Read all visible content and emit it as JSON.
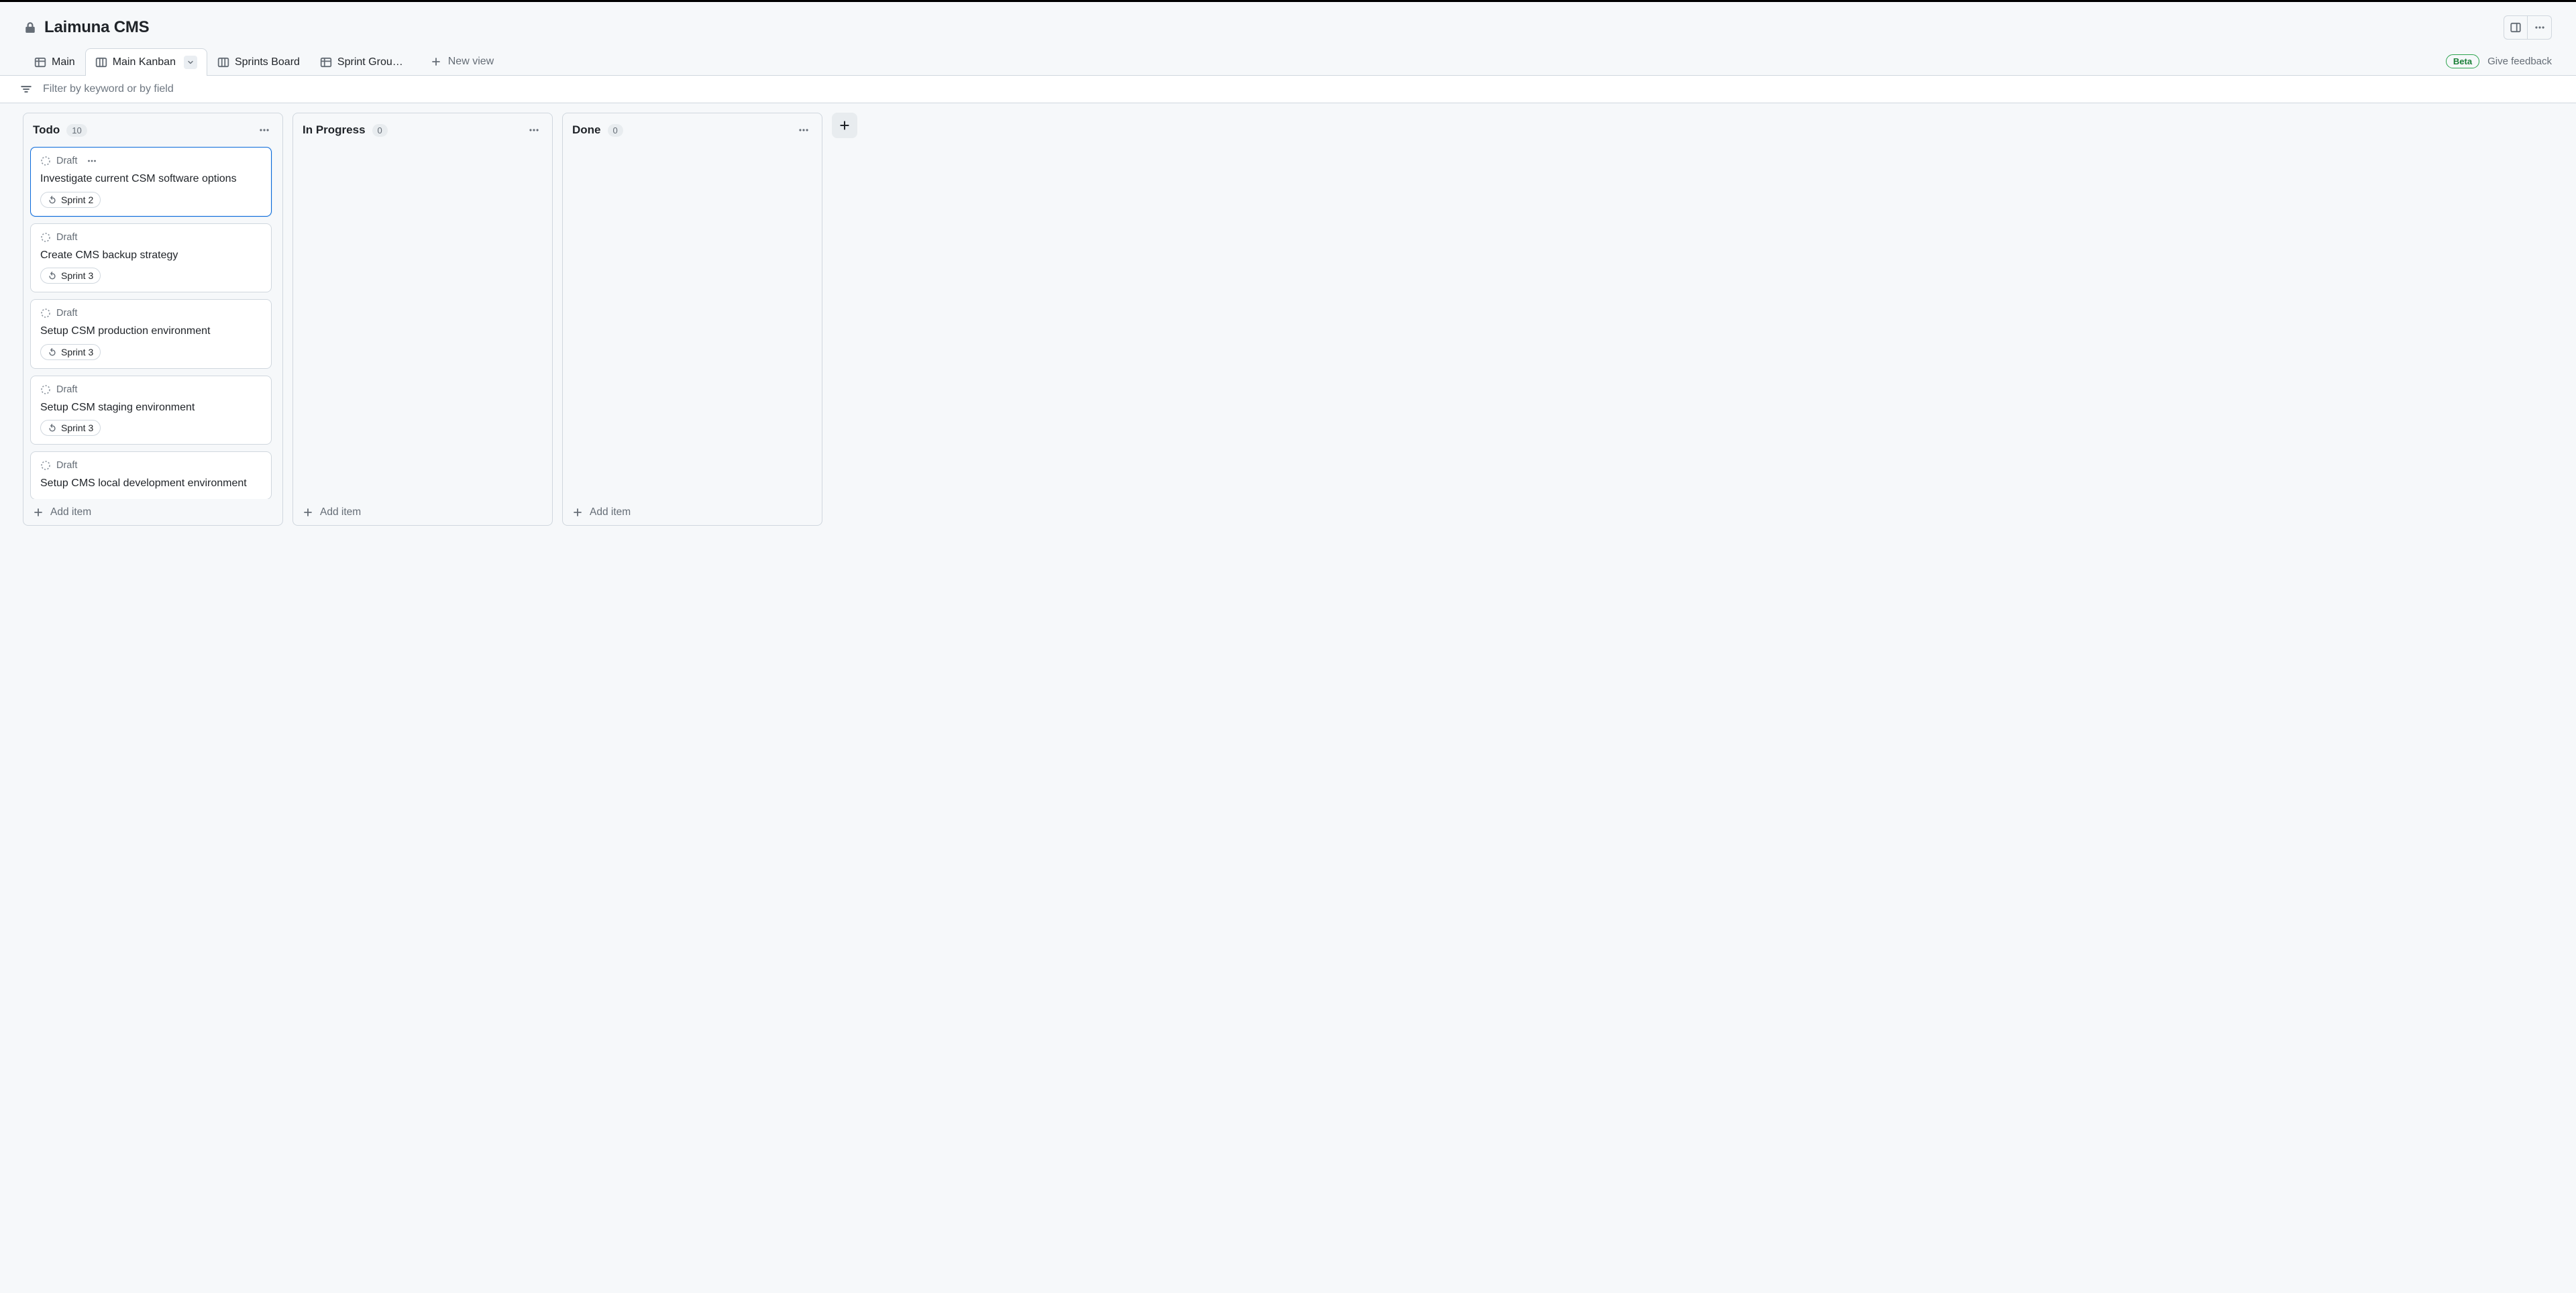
{
  "project": {
    "title": "Laimuna CMS"
  },
  "tabs": {
    "items": [
      {
        "label": "Main",
        "icon": "table"
      },
      {
        "label": "Main Kanban",
        "icon": "board",
        "active": true,
        "dropdown": true
      },
      {
        "label": "Sprints Board",
        "icon": "board"
      },
      {
        "label": "Sprint Grou…",
        "icon": "table"
      }
    ],
    "new_view_label": "New view"
  },
  "badges": {
    "beta": "Beta",
    "feedback": "Give feedback"
  },
  "filter": {
    "placeholder": "Filter by keyword or by field"
  },
  "board": {
    "add_item_label": "Add item",
    "columns": [
      {
        "title": "Todo",
        "count": "10",
        "cards": [
          {
            "status": "Draft",
            "title": "Investigate current CSM software options",
            "sprint": "Sprint 2",
            "selected": true,
            "show_menu": true
          },
          {
            "status": "Draft",
            "title": "Create CMS backup strategy",
            "sprint": "Sprint 3"
          },
          {
            "status": "Draft",
            "title": "Setup CSM production environment",
            "sprint": "Sprint 3"
          },
          {
            "status": "Draft",
            "title": "Setup CSM staging environment",
            "sprint": "Sprint 3"
          },
          {
            "status": "Draft",
            "title": "Setup CMS local development environment"
          }
        ]
      },
      {
        "title": "In Progress",
        "count": "0",
        "cards": []
      },
      {
        "title": "Done",
        "count": "0",
        "cards": []
      }
    ]
  }
}
